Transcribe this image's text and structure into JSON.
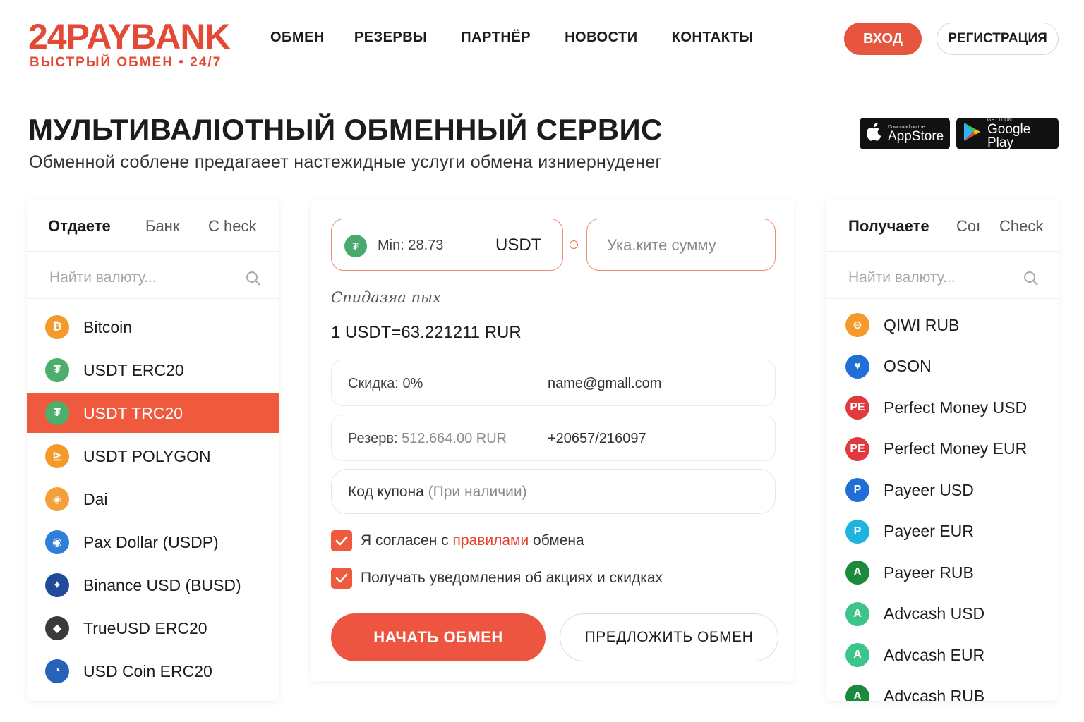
{
  "brand": {
    "name": "24PAYBANK",
    "tagline": "ВЫСТРЫЙ ОБМЕН • 24/7",
    "accent": "#e24a35"
  },
  "nav": [
    {
      "label": "ОБМЕН"
    },
    {
      "label": "РЕЗЕРВЫ"
    },
    {
      "label": "ПАРТНЁР"
    },
    {
      "label": "НОВОСТИ"
    },
    {
      "label": "КОНТАКТЫ"
    }
  ],
  "auth": {
    "login": "ВХОД",
    "register": "РЕГИСТРАЦИЯ"
  },
  "hero": {
    "title": "МУЛЬТИВАЛІОТНЫЙ ОБМЕННЫЙ СЕРВИС",
    "subtitle": "Обменной соблене предагаеет настежидные услуги обмена изниернуденег"
  },
  "stores": {
    "apple": {
      "small": "Download on the",
      "name": "AppStore",
      "icon": "apple-logo"
    },
    "google": {
      "small": "GET IT ON",
      "name": "Google Play",
      "icon": "google-play-logo"
    }
  },
  "give_panel": {
    "tabs": [
      "Отдаете",
      "Банк",
      "С heck"
    ],
    "search_placeholder": "Найти валюту...",
    "items": [
      {
        "name": "Bitcoin",
        "icon": "bitcoin-icon",
        "color": "#f39a2b",
        "glyph": "₿"
      },
      {
        "name": "USDT ERC20",
        "icon": "tether-icon",
        "color": "#4caf6d",
        "glyph": "₮"
      },
      {
        "name": "USDT TRC20",
        "icon": "tether-icon",
        "color": "#4caf6d",
        "glyph": "₮",
        "active": true
      },
      {
        "name": "USDT POLYGON",
        "icon": "polygon-icon",
        "color": "#f39a2b",
        "glyph": "⊵"
      },
      {
        "name": "Dai",
        "icon": "dai-icon",
        "color": "#f3a03a",
        "glyph": "◈"
      },
      {
        "name": "Pax Dollar (USDP)",
        "icon": "pax-icon",
        "color": "#2f7fd8",
        "glyph": "◉"
      },
      {
        "name": "Binance USD (BUSD)",
        "icon": "busd-icon",
        "color": "#214a9a",
        "glyph": "✦"
      },
      {
        "name": "TrueUSD ERC20",
        "icon": "tusd-icon",
        "color": "#3a3a3a",
        "glyph": "◆"
      },
      {
        "name": "USD Coin ERC20",
        "icon": "usdc-icon",
        "color": "#2563b8",
        "glyph": "◔"
      }
    ]
  },
  "exchange": {
    "from_min": "Min: 28.73",
    "from_currency": "USDT",
    "to_placeholder": "Ука.ките сумму",
    "rate_caption": "Спидазяа пых",
    "rate": "1 USDT=63.221211 RUR",
    "discount": "Скидка: 0%",
    "email": "name@gmall.com",
    "reserve_label": "Резерв:",
    "reserve_value": "512.664.00 RUR",
    "phone": "+20657/216097",
    "coupon_label": "Код купона",
    "coupon_hint": "(При наличии)",
    "agree_prefix": "Я согласен с ",
    "agree_link": "правилами",
    "agree_suffix": " обмена",
    "notify": "Получать уведомления об акциях и скидках",
    "start_button": "НАЧАТЬ ОБМЕН",
    "offer_button": "ПРЕДЛОЖИТЬ ОБМЕН",
    "checkboxes_checked": [
      true,
      true
    ]
  },
  "get_panel": {
    "tabs": [
      "Получаете",
      "Сoı",
      "Check"
    ],
    "search_placeholder": "Найти валюту...",
    "items": [
      {
        "name": "QIWI RUB",
        "icon": "qiwi-icon",
        "color": "#f39a2b",
        "glyph": "⊜"
      },
      {
        "name": "OSON",
        "icon": "oson-icon",
        "color": "#1f6fd6",
        "glyph": "♥"
      },
      {
        "name": "Perfect Money USD",
        "icon": "perfect-money-icon",
        "color": "#e0393e",
        "glyph": "PE"
      },
      {
        "name": "Perfect Money EUR",
        "icon": "perfect-money-icon",
        "color": "#e0393e",
        "glyph": "PE"
      },
      {
        "name": "Payeer USD",
        "icon": "payeer-icon",
        "color": "#1f6fd6",
        "glyph": "P"
      },
      {
        "name": "Payeer EUR",
        "icon": "payeer-icon",
        "color": "#1eb3e0",
        "glyph": "P"
      },
      {
        "name": "Payeer RUB",
        "icon": "payeer-icon",
        "color": "#1c8a3c",
        "glyph": "A"
      },
      {
        "name": "Advcash USD",
        "icon": "advcash-icon",
        "color": "#3cc48a",
        "glyph": "A"
      },
      {
        "name": "Advcash EUR",
        "icon": "advcash-icon",
        "color": "#3cc48a",
        "glyph": "A"
      },
      {
        "name": "Advcash RUB",
        "icon": "advcash-icon",
        "color": "#1c8a3c",
        "glyph": "A"
      }
    ]
  }
}
